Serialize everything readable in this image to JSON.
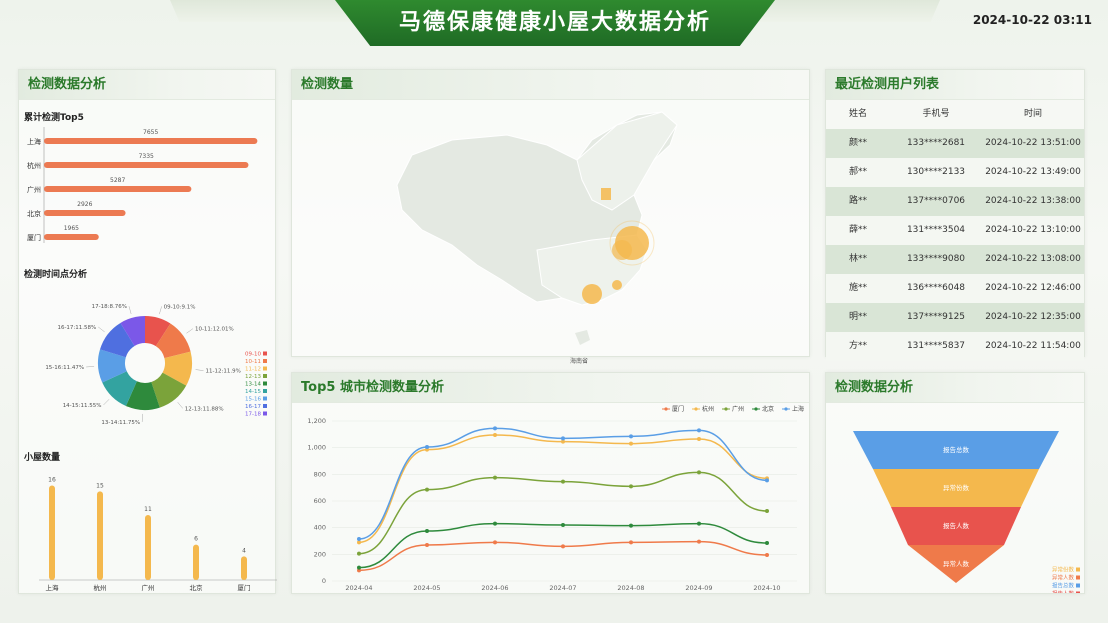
{
  "header": {
    "title": "马德保康健康小屋大数据分析",
    "datetime": "2024-10-22 03:11"
  },
  "left_panel": {
    "title": "检测数据分析",
    "top5": {
      "title": "累计检测Top5",
      "items": [
        {
          "city": "上海",
          "value": 7655
        },
        {
          "city": "杭州",
          "value": 7335
        },
        {
          "city": "广州",
          "value": 5287
        },
        {
          "city": "北京",
          "value": 2926
        },
        {
          "city": "厦门",
          "value": 1965
        }
      ]
    },
    "time_analysis": {
      "title": "检测时间点分析"
    },
    "house_count": {
      "title": "小屋数量",
      "categories": [
        "上海",
        "杭州",
        "广州",
        "北京",
        "厦门"
      ],
      "values": [
        16,
        15,
        11,
        6,
        4
      ]
    }
  },
  "chart_data": [
    {
      "type": "bar",
      "title": "累计检测Top5",
      "categories": [
        "上海",
        "杭州",
        "广州",
        "北京",
        "厦门"
      ],
      "values": [
        7655,
        7335,
        5287,
        2926,
        1965
      ]
    },
    {
      "type": "pie",
      "title": "检测时间点分析",
      "slices": [
        {
          "label": "09-10",
          "percent": 9.1,
          "color": "#e8534d"
        },
        {
          "label": "10-11",
          "percent": 12.01,
          "color": "#ef7a4a"
        },
        {
          "label": "11-12",
          "percent": 11.9,
          "color": "#f4b84d"
        },
        {
          "label": "12-13",
          "percent": 11.88,
          "color": "#7ba33a"
        },
        {
          "label": "13-14",
          "percent": 11.75,
          "color": "#2e8a3c"
        },
        {
          "label": "14-15",
          "percent": 11.55,
          "color": "#33a3a0"
        },
        {
          "label": "15-16",
          "percent": 11.47,
          "color": "#5a9ee6"
        },
        {
          "label": "16-17",
          "percent": 11.58,
          "color": "#4f6fe0"
        },
        {
          "label": "17-18",
          "percent": 8.76,
          "color": "#7b58e8"
        }
      ],
      "slice_labels": [
        "09-10:9.1%",
        "10-11:12.01%",
        "11-12:11.9%",
        "12-13:11.88%",
        "13-14:11.75%",
        "14-15:11.55%",
        "15-16:11.47%",
        "16-17:11.58%",
        "17-18:8.76%"
      ]
    },
    {
      "type": "bar",
      "title": "小屋数量",
      "categories": [
        "上海",
        "杭州",
        "广州",
        "北京",
        "厦门"
      ],
      "values": [
        16,
        15,
        11,
        6,
        4
      ]
    },
    {
      "type": "line",
      "title": "Top5 城市检测数量分析",
      "categories": [
        "2024-04",
        "2024-05",
        "2024-06",
        "2024-07",
        "2024-08",
        "2024-09",
        "2024-10"
      ],
      "ylim": [
        0,
        1200
      ],
      "yticks": [
        0,
        200,
        400,
        600,
        800,
        "1,000",
        "1,200"
      ],
      "series": [
        {
          "name": "厦门",
          "color": "#ef7a4a",
          "values": [
            80,
            270,
            290,
            260,
            290,
            295,
            195
          ]
        },
        {
          "name": "杭州",
          "color": "#f4b84d",
          "values": [
            290,
            985,
            1095,
            1045,
            1030,
            1065,
            770
          ]
        },
        {
          "name": "广州",
          "color": "#7ba33a",
          "values": [
            205,
            685,
            775,
            745,
            710,
            815,
            525
          ]
        },
        {
          "name": "北京",
          "color": "#2e8a3c",
          "values": [
            100,
            375,
            430,
            420,
            415,
            430,
            285
          ]
        },
        {
          "name": "上海",
          "color": "#5a9ee6",
          "values": [
            315,
            1005,
            1145,
            1070,
            1085,
            1130,
            755
          ]
        }
      ]
    },
    {
      "type": "funnel",
      "title": "检测数据分析",
      "stages": [
        {
          "label": "报告总数",
          "color": "#5a9ee6"
        },
        {
          "label": "异常份数",
          "color": "#f4b84d"
        },
        {
          "label": "报告人数",
          "color": "#e8534d"
        },
        {
          "label": "异常人数",
          "color": "#ef7a4a"
        }
      ],
      "legend": [
        {
          "label": "异常份数",
          "color": "#f4b84d"
        },
        {
          "label": "异常人数",
          "color": "#ef7a4a"
        },
        {
          "label": "报告总数",
          "color": "#5a9ee6"
        },
        {
          "label": "报告人数",
          "color": "#e8534d"
        }
      ]
    }
  ],
  "map_panel": {
    "title": "检测数量",
    "sea_label": "海南省"
  },
  "users_panel": {
    "title": "最近检测用户列表",
    "columns": [
      "姓名",
      "手机号",
      "时间"
    ],
    "rows": [
      {
        "name": "颜**",
        "phone": "133****2681",
        "time": "2024-10-22 13:51:00"
      },
      {
        "name": "郝**",
        "phone": "130****2133",
        "time": "2024-10-22 13:49:00"
      },
      {
        "name": "路**",
        "phone": "137****0706",
        "time": "2024-10-22 13:38:00"
      },
      {
        "name": "薛**",
        "phone": "131****3504",
        "time": "2024-10-22 13:10:00"
      },
      {
        "name": "林**",
        "phone": "133****9080",
        "time": "2024-10-22 13:08:00"
      },
      {
        "name": "施**",
        "phone": "136****6048",
        "time": "2024-10-22 12:46:00"
      },
      {
        "name": "明**",
        "phone": "137****9125",
        "time": "2024-10-22 12:35:00"
      },
      {
        "name": "方**",
        "phone": "131****5837",
        "time": "2024-10-22 11:54:00"
      }
    ]
  },
  "line_panel": {
    "title": "Top5 城市检测数量分析"
  },
  "funnel_panel": {
    "title": "检测数据分析"
  }
}
